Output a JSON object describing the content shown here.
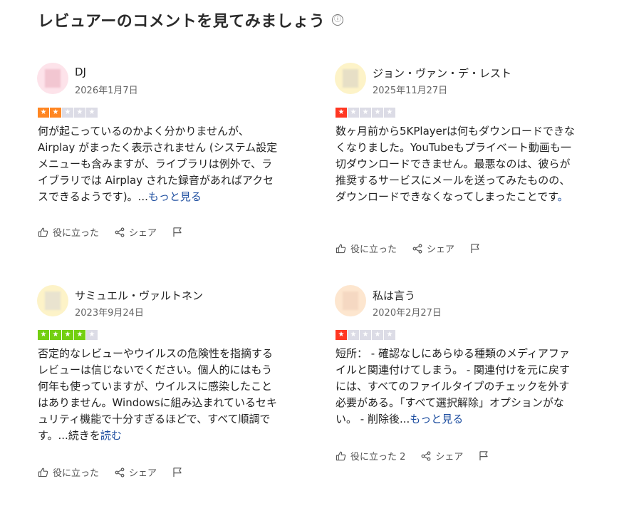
{
  "header": {
    "title": "レビュアーのコメントを見てみましょう",
    "info_icon": "ⓘ"
  },
  "reviews": [
    {
      "author": "DJ",
      "date": "2026年1月7日",
      "rating": 2,
      "star_color": "#ff8622",
      "avatar_bg": "#fde3ea",
      "avatar_blur": "#f2c6d1",
      "text": "何が起こっているのかよく分かりませんが、Airplay がまったく表示されません (システム設定メニューも含みますが、ライブラリは例外で、ライブラリでは Airplay された録音があればアクセスできるようです)。...",
      "more": "もっと見る",
      "helpful": "役に立った",
      "share": "シェア"
    },
    {
      "author": "ジョン・ヴァン・デ・レスト",
      "date": "2025年11月27日",
      "rating": 1,
      "star_color": "#ff3722",
      "avatar_bg": "#fdf3c8",
      "avatar_blur": "#e7dfc6",
      "text": "数ヶ月前から5KPlayerは何もダウンロードできなくなりました。YouTubeもプライベート動画も一切ダウンロードできません。最悪なのは、彼らが推奨するサービスにメールを送ってみたものの、ダウンロードできなくなってしまったことです",
      "more": "。",
      "helpful": "役に立った",
      "share": "シェア"
    },
    {
      "author": "サミュエル・ヴァルトネン",
      "date": "2023年9月24日",
      "rating": 4,
      "star_color": "#73cf11",
      "avatar_bg": "#fdf3c8",
      "avatar_blur": "#e9e3cf",
      "text": "否定的なレビューやウイルスの危険性を指摘するレビューは信じないでください。個人的にはもう何年も使っていますが、ウイルスに感染したことはありません。Windowsに組み込まれているセキュリティ機能で十分すぎるほどで、すべて順調です。...続きを",
      "more": "読む",
      "helpful": "役に立った",
      "share": "シェア"
    },
    {
      "author": "私は言う",
      "date": "2020年2月27日",
      "rating": 1,
      "star_color": "#ff3722",
      "avatar_bg": "#fde6cf",
      "avatar_blur": "#f5d8c2",
      "text": "短所： - 確認なしにあらゆる種類のメディアファイルと関連付けてしまう。 - 関連付けを元に戻すには、すべてのファイルタイプのチェックを外す必要がある。「すべて選択解除」オプションがない。 - 削除後...",
      "more": "もっと見る",
      "helpful": "役に立った 2",
      "share": "シェア"
    }
  ]
}
